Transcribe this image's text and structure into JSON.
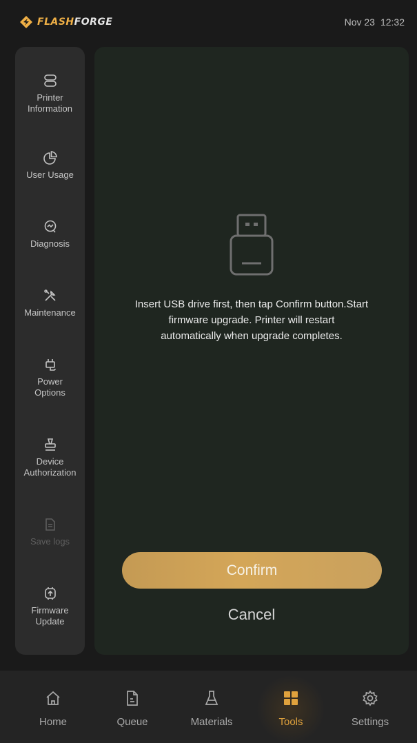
{
  "header": {
    "brand_prefix": "FLASH",
    "brand_suffix": "FORGE",
    "date": "Nov 23",
    "time": "12:32"
  },
  "sidebar": {
    "items": [
      {
        "label_line1": "Printer",
        "label_line2": "Information",
        "icon": "printer-info-icon",
        "enabled": true
      },
      {
        "label_line1": "User Usage",
        "label_line2": "",
        "icon": "pie-chart-icon",
        "enabled": true
      },
      {
        "label_line1": "Diagnosis",
        "label_line2": "",
        "icon": "diagnosis-icon",
        "enabled": true
      },
      {
        "label_line1": "Maintenance",
        "label_line2": "",
        "icon": "wrench-screwdriver-icon",
        "enabled": true
      },
      {
        "label_line1": "Power",
        "label_line2": "Options",
        "icon": "power-plug-icon",
        "enabled": true
      },
      {
        "label_line1": "Device",
        "label_line2": "Authorization",
        "icon": "stamp-icon",
        "enabled": true
      },
      {
        "label_line1": "Save logs",
        "label_line2": "",
        "icon": "document-icon",
        "enabled": false
      },
      {
        "label_line1": "Firmware",
        "label_line2": "Update",
        "icon": "chip-upload-icon",
        "enabled": true
      }
    ]
  },
  "main": {
    "icon": "usb-drive-icon",
    "message_line1": "Insert USB drive first, then tap Confirm button.Start",
    "message_line2": "firmware upgrade. Printer will restart",
    "message_line3": "automatically when upgrade completes.",
    "confirm_label": "Confirm",
    "cancel_label": "Cancel"
  },
  "bottom_nav": {
    "items": [
      {
        "label": "Home",
        "icon": "home-icon",
        "active": false
      },
      {
        "label": "Queue",
        "icon": "file-icon",
        "active": false
      },
      {
        "label": "Materials",
        "icon": "flask-icon",
        "active": false
      },
      {
        "label": "Tools",
        "icon": "grid-icon",
        "active": true
      },
      {
        "label": "Settings",
        "icon": "gear-icon",
        "active": false
      }
    ]
  },
  "colors": {
    "accent": "#e0a23d",
    "confirm_button": "#d4a658",
    "background": "#1a1a1a",
    "panel": "#1f2620",
    "sidebar": "#2c2c2c"
  }
}
